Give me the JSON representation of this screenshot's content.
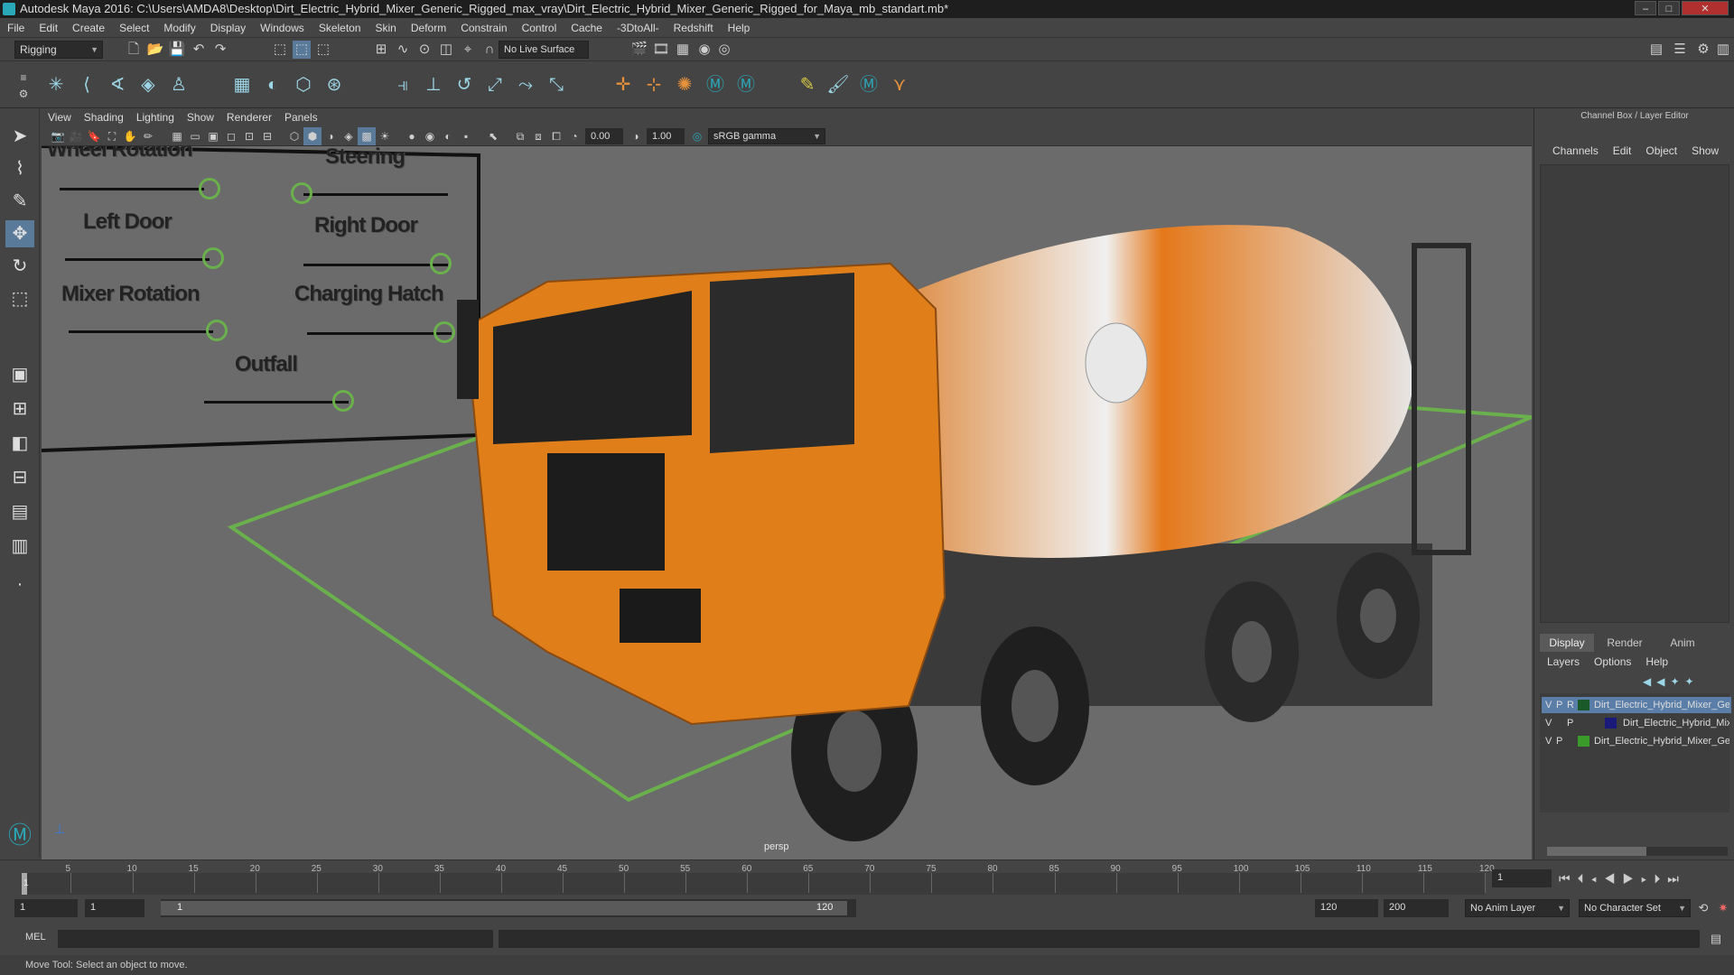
{
  "window": {
    "title": "Autodesk Maya 2016: C:\\Users\\AMDA8\\Desktop\\Dirt_Electric_Hybrid_Mixer_Generic_Rigged_max_vray\\Dirt_Electric_Hybrid_Mixer_Generic_Rigged_for_Maya_mb_standart.mb*",
    "controls": [
      "–",
      "□",
      "✕"
    ]
  },
  "menus": [
    "File",
    "Edit",
    "Create",
    "Select",
    "Modify",
    "Display",
    "Windows",
    "Skeleton",
    "Skin",
    "Deform",
    "Constrain",
    "Control",
    "Cache",
    "-3DtoAll-",
    "Redshift",
    "Help"
  ],
  "status": {
    "menu_set": "Rigging",
    "live_surface": "No Live Surface"
  },
  "panel_menus": [
    "View",
    "Shading",
    "Lighting",
    "Show",
    "Renderer",
    "Panels"
  ],
  "panel_toolbar": {
    "exposure": "0.00",
    "gamma": "1.00",
    "color_space": "sRGB gamma"
  },
  "viewport": {
    "camera": "persp"
  },
  "rig_controls": [
    {
      "label": "Wheel Rotation"
    },
    {
      "label": "Steering"
    },
    {
      "label": "Left Door"
    },
    {
      "label": "Right Door"
    },
    {
      "label": "Mixer Rotation"
    },
    {
      "label": "Charging Hatch"
    },
    {
      "label": "Outfall"
    }
  ],
  "channel_box": {
    "title": "Channel Box / Layer Editor",
    "menus": [
      "Channels",
      "Edit",
      "Object",
      "Show"
    ]
  },
  "layer_editor": {
    "tabs": [
      "Display",
      "Render",
      "Anim"
    ],
    "menus": [
      "Layers",
      "Options",
      "Help"
    ],
    "layers": [
      {
        "v": "V",
        "p": "P",
        "r": "R",
        "name": "Dirt_Electric_Hybrid_Mixer_Generic",
        "color": "#1a5a2a",
        "selected": true
      },
      {
        "v": "V",
        "p": "P",
        "r": "",
        "name": "Dirt_Electric_Hybrid_Mixer_Generic",
        "color": "#1a1a7a",
        "selected": false
      },
      {
        "v": "V",
        "p": "P",
        "r": "",
        "name": "Dirt_Electric_Hybrid_Mixer_Generic",
        "color": "#3a9a2a",
        "selected": false
      }
    ]
  },
  "timeline": {
    "ticks": [
      "5",
      "10",
      "15",
      "20",
      "25",
      "30",
      "35",
      "40",
      "45",
      "50",
      "55",
      "60",
      "65",
      "70",
      "75",
      "80",
      "85",
      "90",
      "95",
      "100",
      "105",
      "110",
      "115",
      "120"
    ],
    "start_label": "1",
    "current_frame": "1"
  },
  "range": {
    "start": "1",
    "playback_start": "1",
    "slider_start": "1",
    "slider_end": "120",
    "playback_end": "120",
    "end": "200",
    "anim_layer": "No Anim Layer",
    "character_set": "No Character Set"
  },
  "command": {
    "label": "MEL"
  },
  "help_line": "Move Tool: Select an object to move."
}
